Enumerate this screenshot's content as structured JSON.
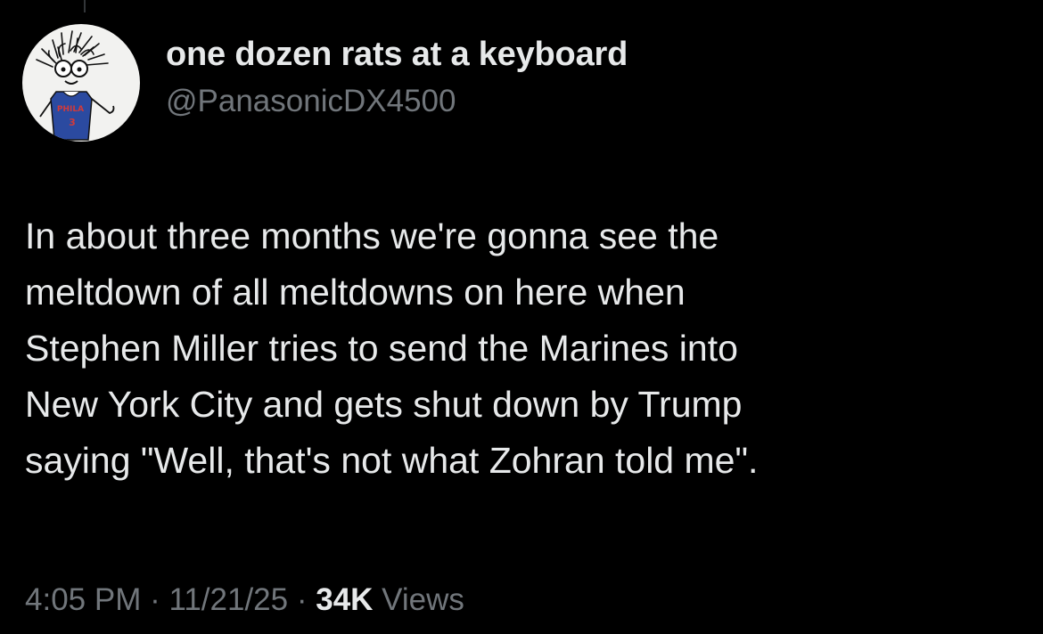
{
  "author": {
    "display_name": "one dozen rats at a keyboard",
    "handle": "@PanasonicDX4500",
    "avatar": {
      "icon": "cartoon-avatar-icon",
      "jersey_text": "PHILA",
      "jersey_number": "3"
    }
  },
  "tweet": {
    "text": "In about three months we're gonna see the\nmeltdown of all meltdowns on here when\nStephen Miller tries to send the Marines into\nNew York City and gets shut down by Trump\nsaying \"Well, that's not what Zohran told me\"."
  },
  "meta": {
    "time": "4:05 PM",
    "separator_1": " · ",
    "date": "11/21/25",
    "separator_2": " · ",
    "views_count": "34K",
    "views_label": " Views"
  },
  "colors": {
    "background": "#000000",
    "primary_text": "#e7e9ea",
    "secondary_text": "#71767b",
    "jersey_blue": "#2b4aa0",
    "jersey_red": "#d23a3a"
  }
}
